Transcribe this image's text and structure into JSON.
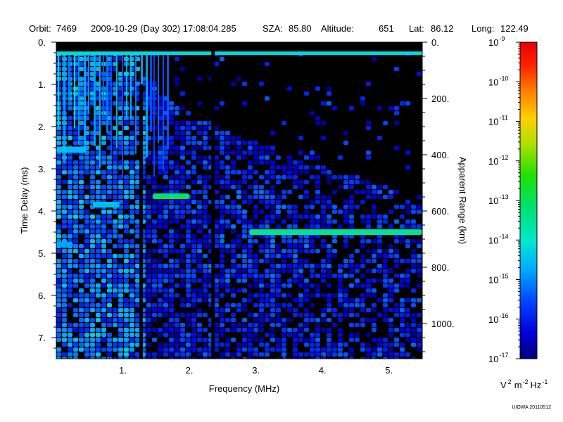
{
  "header": {
    "orbit_label": "Orbit:",
    "orbit": "7469",
    "datetime": "2009-10-29 (Day 302) 17:08:04.285",
    "sza_label": "SZA:",
    "sza": "85.80",
    "altitude_label": "Altitude:",
    "altitude": "651",
    "lat_label": "Lat:",
    "lat": "86.12",
    "long_label": "Long:",
    "long": "122.49"
  },
  "credit": "UIOWA 20110512",
  "chart_data": {
    "type": "heatmap",
    "title": "",
    "xlabel": "Frequency (MHz)",
    "ylabel": "Time Delay (ms)",
    "y2label": "Apparent Range (km)",
    "xlim": [
      0,
      5.5
    ],
    "ylim": [
      7.5,
      0
    ],
    "x_ticks": [
      {
        "value": 1,
        "label": "1."
      },
      {
        "value": 2,
        "label": "2."
      },
      {
        "value": 3,
        "label": "3."
      },
      {
        "value": 4,
        "label": "4."
      },
      {
        "value": 5,
        "label": "5."
      }
    ],
    "y_ticks": [
      {
        "value": 0,
        "label": "0."
      },
      {
        "value": 1,
        "label": "1."
      },
      {
        "value": 2,
        "label": "2."
      },
      {
        "value": 3,
        "label": "3."
      },
      {
        "value": 4,
        "label": "4."
      },
      {
        "value": 5,
        "label": "5."
      },
      {
        "value": 6,
        "label": "6."
      },
      {
        "value": 7,
        "label": "7."
      }
    ],
    "y2_ticks": [
      {
        "value": 0,
        "label": "0."
      },
      {
        "value": 200,
        "label": "200."
      },
      {
        "value": 400,
        "label": "400."
      },
      {
        "value": 600,
        "label": "600."
      },
      {
        "value": 800,
        "label": "800."
      },
      {
        "value": 1000,
        "label": "1000."
      }
    ],
    "y2_km_per_ms": 150,
    "colorbar": {
      "scale": "log",
      "min_exp": -17,
      "max_exp": -9,
      "tick_exponents": [
        -9,
        -10,
        -11,
        -12,
        -13,
        -14,
        -15,
        -16,
        -17
      ],
      "tick_base": "10",
      "unit": {
        "v": "V",
        "v_exp": "2",
        "m": "m",
        "m_exp": "-2",
        "hz": "Hz",
        "hz_exp": "-1"
      }
    },
    "features": [
      {
        "kind": "echo",
        "label": "",
        "x_range": [
          2.9,
          5.5
        ],
        "delay_ms": 4.5,
        "level_exp": -13.5
      },
      {
        "kind": "echo",
        "label": "",
        "x_range": [
          1.45,
          2.0
        ],
        "delay_ms": 3.65,
        "level_exp": -13.2
      },
      {
        "kind": "echo",
        "label": "",
        "x_range": [
          0.55,
          0.95
        ],
        "delay_ms": 3.85,
        "level_exp": -14.5
      },
      {
        "kind": "echo",
        "label": "",
        "x_range": [
          0.0,
          0.45
        ],
        "delay_ms": 2.55,
        "level_exp": -14.5
      },
      {
        "kind": "echo",
        "label": "",
        "x_range": [
          0.0,
          0.25
        ],
        "delay_ms": 4.8,
        "level_exp": -14.8
      },
      {
        "kind": "band",
        "label": "",
        "x_range": [
          0.0,
          5.5
        ],
        "delay_ms": 0.27,
        "level_exp": -14.2
      },
      {
        "kind": "gap",
        "label": "",
        "x_value": 2.35,
        "delay_range": [
          0.1,
          7.5
        ]
      },
      {
        "kind": "gap",
        "label": "",
        "x_value": 1.27,
        "delay_range": [
          1.0,
          7.5
        ]
      }
    ]
  }
}
